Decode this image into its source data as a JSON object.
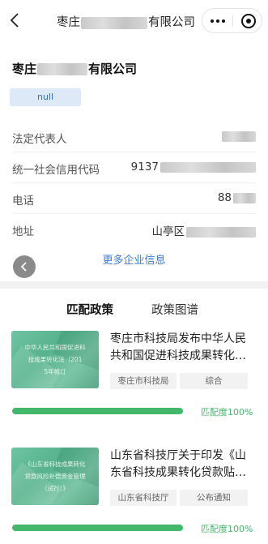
{
  "nav": {
    "title_prefix": "枣庄",
    "title_suffix": "有限公司"
  },
  "company": {
    "name_prefix": "枣庄",
    "name_suffix": "有限公司",
    "tag": "null"
  },
  "info": [
    {
      "label": "法定代表人",
      "value": ""
    },
    {
      "label": "统一社会信用代码",
      "value": "9137"
    },
    {
      "label": "电话",
      "value": "88"
    },
    {
      "label": "地址",
      "value": "山亭区"
    }
  ],
  "more_info_link": "更多企业信息",
  "tabs": [
    {
      "label": "匹配政策",
      "active": true
    },
    {
      "label": "政策图谱",
      "active": false
    }
  ],
  "policies": [
    {
      "title": "枣庄市科技局发布中华人民共和国促进科技成果转化…",
      "thumb_lines": [
        "中华人民共和国促进科",
        "技成果转化法（201",
        "5年修订"
      ],
      "tags": [
        "枣庄市科技局",
        "综合"
      ],
      "match_fraction": 1.0,
      "match_label": "匹配度100%"
    },
    {
      "title": "山东省科技厅关于印发《山东省科技成果转化贷款贴…",
      "thumb_lines": [
        "《山东省科技成果转化",
        "贷款风险补偿资金管理",
        "（试行）》"
      ],
      "tags": [
        "山东省科技厅",
        "公布通知"
      ],
      "match_fraction": 1.0,
      "match_label": "匹配度100%"
    }
  ],
  "colors": {
    "accent_blue": "#3a7bd5",
    "match_green": "#43b86b",
    "tag_bg": "#dde9f7"
  }
}
